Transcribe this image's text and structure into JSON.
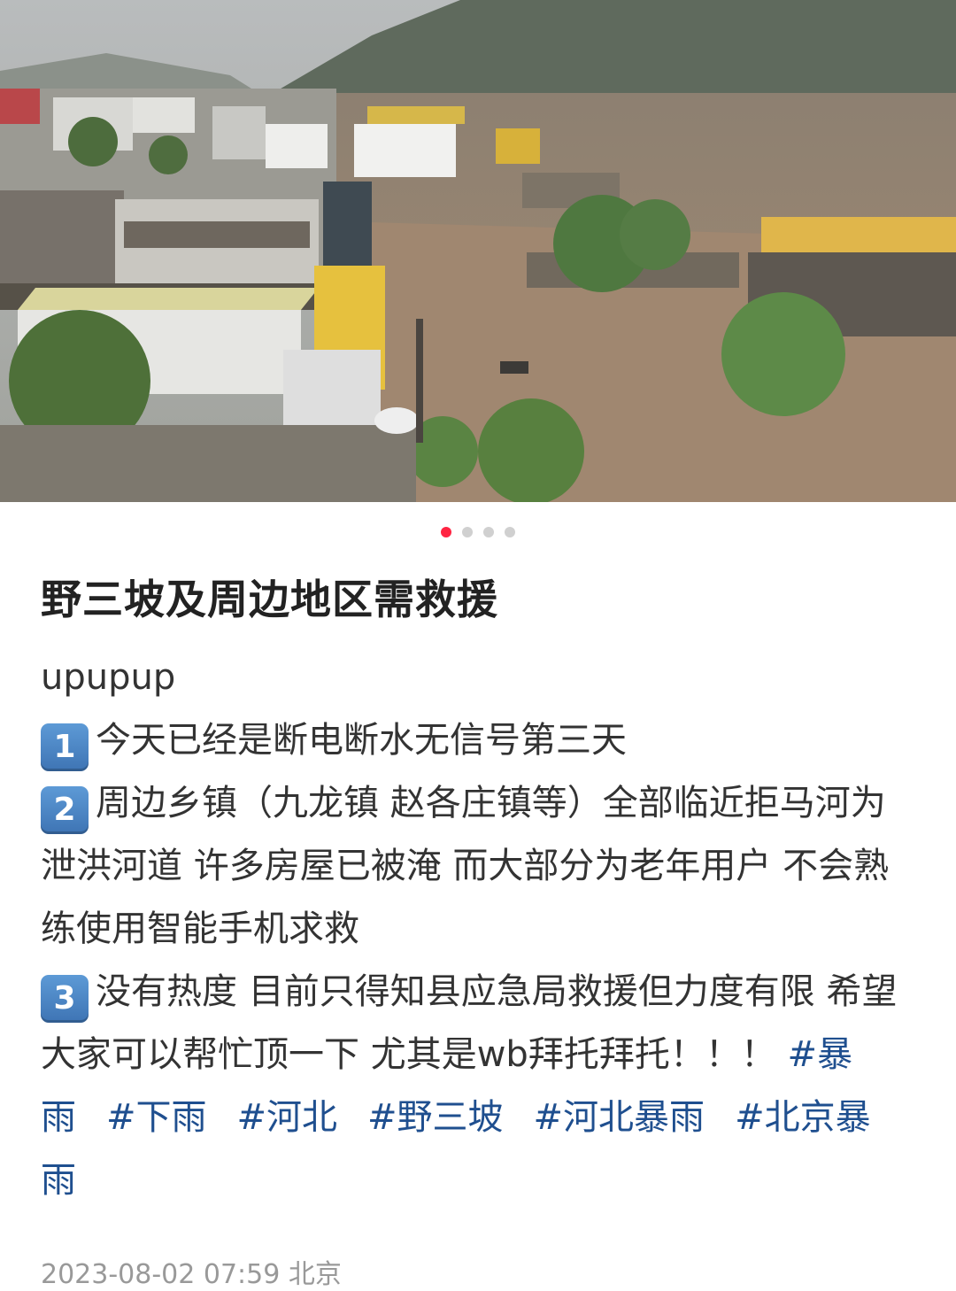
{
  "post": {
    "image_alt": "flooded town photo",
    "carousel": {
      "count": 4,
      "active": 0
    },
    "title": "野三坡及周边地区需救援",
    "author_line": "upupup",
    "items": [
      {
        "num": "1",
        "text": "今天已经是断电断水无信号第三天"
      },
      {
        "num": "2",
        "text": "周边乡镇（九龙镇 赵各庄镇等）全部临近拒马河为泄洪河道 许多房屋已被淹 而大部分为老年用户 不会熟练使用智能手机求救"
      },
      {
        "num": "3",
        "text": "没有热度 目前只得知县应急局救援但力度有限 希望大家可以帮忙顶一下 尤其是wb拜托拜托！！！"
      }
    ],
    "tags": [
      "#暴雨",
      "#下雨",
      "#河北",
      "#野三坡",
      "#河北暴雨",
      "#北京暴雨"
    ],
    "timestamp": "2023-08-02 07:59 北京"
  }
}
